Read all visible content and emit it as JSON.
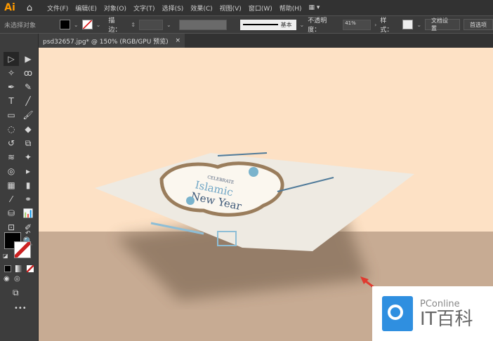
{
  "app": {
    "logo": "Ai"
  },
  "menu": [
    "文件(F)",
    "编辑(E)",
    "对象(O)",
    "文字(T)",
    "选择(S)",
    "效果(C)",
    "视图(V)",
    "窗口(W)",
    "帮助(H)"
  ],
  "control": {
    "selection": "未选择对象",
    "stroke_label": "描边：",
    "stroke_style": "基本",
    "opacity_label": "不透明度：",
    "opacity_value": "41%",
    "style_label": "样式：",
    "doc_setup": "文档设置",
    "prefs": "首选项"
  },
  "tab": {
    "title": "psd32657.jpg* @ 150% (RGB/GPU 预览)",
    "close": "×"
  },
  "artwork": {
    "line1": "CELEBRATE",
    "line2": "Islamic",
    "line3": "New Year"
  },
  "watermark": {
    "top": "PConline",
    "bottom": "IT百科"
  },
  "colors": {
    "accent": "#ff9a00",
    "canvas_top": "#fde1c5",
    "canvas_floor": "#c7ab93",
    "arrow": "#e03a2f",
    "wm_blue": "#2f8fe0"
  }
}
